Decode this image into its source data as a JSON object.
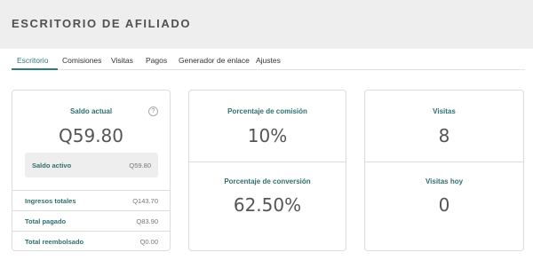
{
  "header": {
    "title": "ESCRITORIO DE AFILIADO"
  },
  "tabs": [
    {
      "label": "Escritorio"
    },
    {
      "label": "Comisiones"
    },
    {
      "label": "Visitas"
    },
    {
      "label": "Pagos"
    },
    {
      "label": "Generador de enlace"
    },
    {
      "label": "Ajustes"
    }
  ],
  "balance": {
    "label": "Saldo actual",
    "value": "Q59.80",
    "help_icon": "question-circle-icon",
    "active_label": "Saldo activo",
    "active_value": "Q59.80",
    "rows": [
      {
        "label": "Ingresos totales",
        "value": "Q143.70"
      },
      {
        "label": "Total pagado",
        "value": "Q83.90"
      },
      {
        "label": "Total reembolsado",
        "value": "Q0.00"
      }
    ]
  },
  "commission": {
    "rate_label": "Porcentaje de comisión",
    "rate_value": "10%",
    "conversion_label": "Porcentaje de conversión",
    "conversion_value": "62.50%"
  },
  "visits": {
    "total_label": "Visitas",
    "total_value": "8",
    "today_label": "Visitas hoy",
    "today_value": "0"
  },
  "colors": {
    "accent": "#2f7d7a",
    "header_bg": "#eeeeee"
  }
}
